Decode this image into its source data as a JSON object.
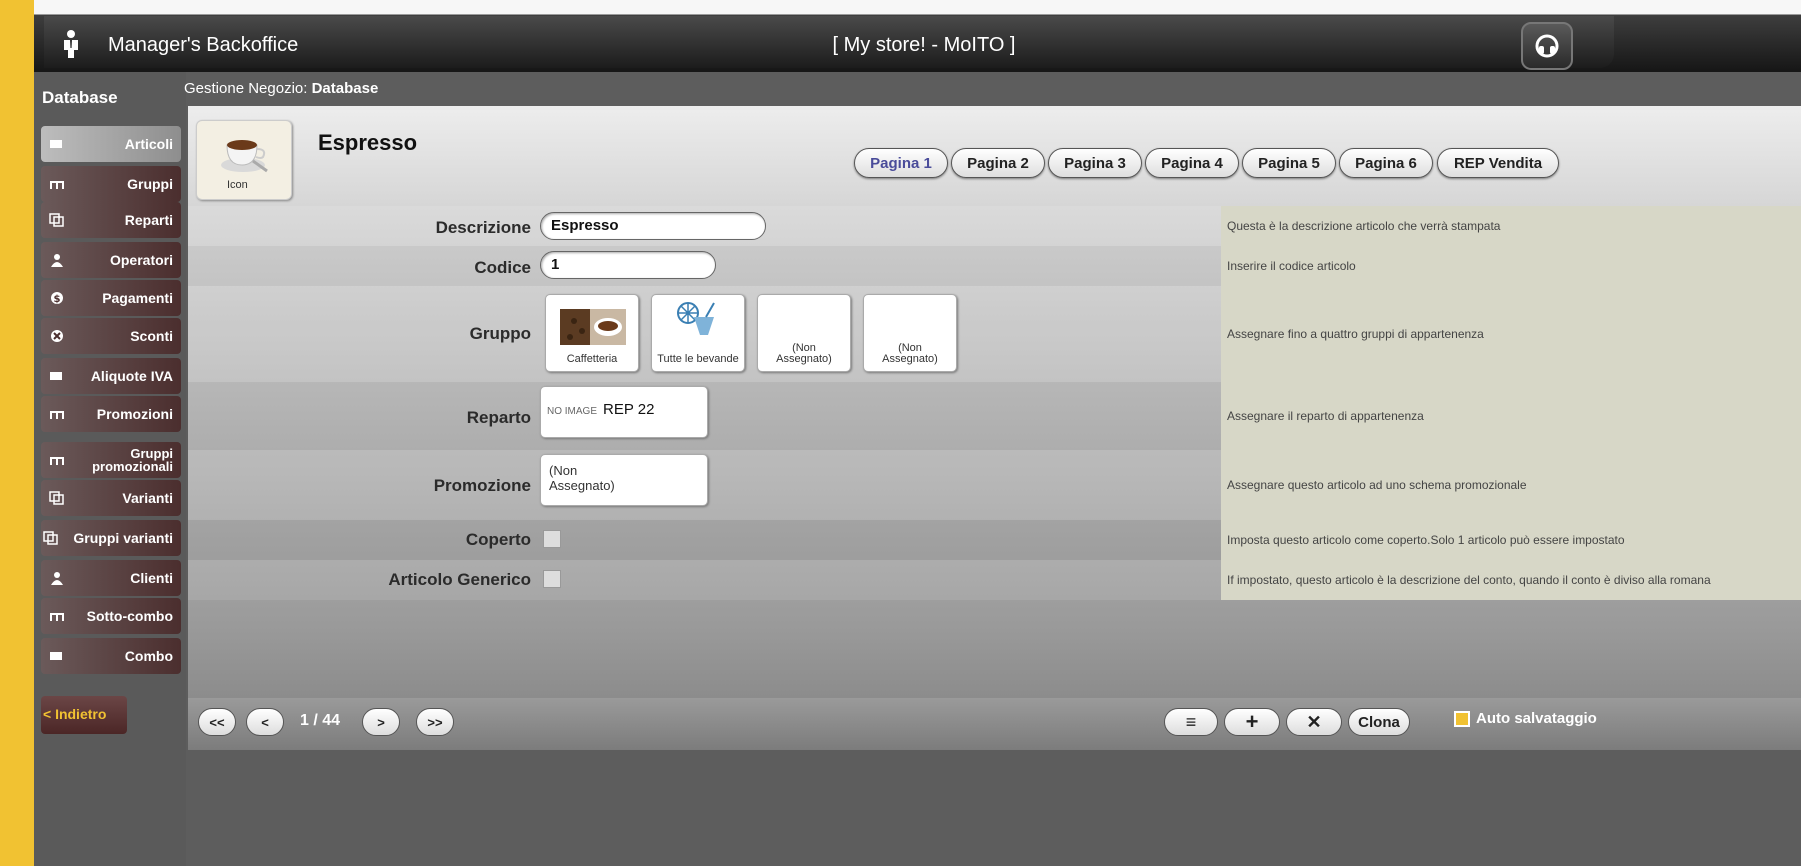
{
  "app": {
    "title": "Manager's Backoffice",
    "store": "[ My store!  -  MoITO ]",
    "help_icon": "help-icon"
  },
  "sidebar": {
    "title": "Database",
    "items": [
      {
        "label": "Articoli",
        "icon": "square-icon"
      },
      {
        "label": "Gruppi",
        "icon": "hierarchy-icon"
      },
      {
        "label": "Reparti",
        "icon": "copy-icon"
      },
      {
        "label": "Operatori",
        "icon": "user-icon"
      },
      {
        "label": "Pagamenti",
        "icon": "dollar-icon"
      },
      {
        "label": "Sconti",
        "icon": "discount-icon"
      },
      {
        "label": "Aliquote IVA",
        "icon": "square-icon"
      },
      {
        "label": "Promozioni",
        "icon": "hierarchy-icon"
      },
      {
        "label": "Gruppi promozionali",
        "icon": "hierarchy-icon"
      },
      {
        "label": "Varianti",
        "icon": "copy-icon"
      },
      {
        "label": "Gruppi varianti",
        "icon": "copy-icon"
      },
      {
        "label": "Clienti",
        "icon": "user-icon"
      },
      {
        "label": "Sotto-combo",
        "icon": "hierarchy-icon"
      },
      {
        "label": "Combo",
        "icon": "square-icon"
      }
    ],
    "back": "< Indietro"
  },
  "breadcrumb": {
    "prefix": "Gestione Negozio: ",
    "current": "Database"
  },
  "item": {
    "title": "Espresso",
    "icon_caption": "Icon"
  },
  "tabs": [
    "Pagina 1",
    "Pagina 2",
    "Pagina 3",
    "Pagina 4",
    "Pagina 5",
    "Pagina 6",
    "REP Vendita"
  ],
  "form": {
    "descrizione": {
      "label": "Descrizione",
      "value": "Espresso",
      "help": "Questa è la descrizione articolo che verrà stampata"
    },
    "codice": {
      "label": "Codice",
      "value": "1",
      "help": "Inserire il codice articolo"
    },
    "gruppo": {
      "label": "Gruppo",
      "help": "Assegnare fino a quattro gruppi di appartenenza",
      "cards": [
        "Caffetteria",
        "Tutte le bevande",
        "(Non Assegnato)",
        "(Non Assegnato)"
      ]
    },
    "reparto": {
      "label": "Reparto",
      "no_image": "NO IMAGE",
      "value": "REP 22",
      "help": "Assegnare il reparto di appartenenza"
    },
    "promozione": {
      "label": "Promozione",
      "value": "(Non Assegnato)",
      "help": "Assegnare questo articolo ad uno schema promozionale"
    },
    "coperto": {
      "label": "Coperto",
      "help": "Imposta questo articolo come coperto.Solo 1 articolo può essere impostato"
    },
    "generico": {
      "label": "Articolo Generico",
      "help": "If impostato, questo articolo è la descrizione del conto, quando il conto è diviso alla romana"
    }
  },
  "pager": {
    "first": "<<",
    "prev": "<",
    "counter": "1 / 44",
    "next": ">",
    "last": ">>"
  },
  "actions": {
    "menu": "≡",
    "add": "+",
    "delete": "✕",
    "clone": "Clona",
    "autosave": "Auto salvataggio"
  }
}
